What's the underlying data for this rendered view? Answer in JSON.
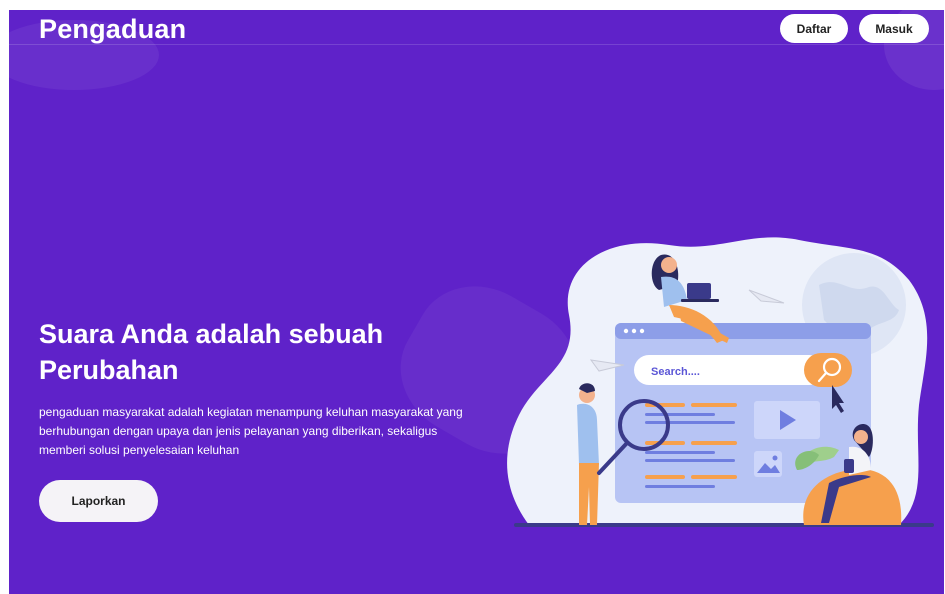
{
  "navbar": {
    "brand": "Pengaduan",
    "register_label": "Daftar",
    "login_label": "Masuk"
  },
  "hero": {
    "title": "Suara Anda adalah sebuah Perubahan",
    "description": "pengaduan masyarakat adalah kegiatan menampung keluhan masyarakat yang berhubungan dengan upaya dan jenis pelayanan yang diberikan, sekaligus memberi solusi penyelesaian keluhan",
    "cta_label": "Laporkan"
  },
  "illustration": {
    "search_placeholder": "Search....",
    "icons": [
      "search-icon",
      "cursor-icon",
      "play-icon",
      "image-icon",
      "paper-plane-icon",
      "globe-icon"
    ]
  },
  "colors": {
    "background": "#5f22c9",
    "button_bg": "#ffffff",
    "accent_orange": "#f6a04d"
  }
}
